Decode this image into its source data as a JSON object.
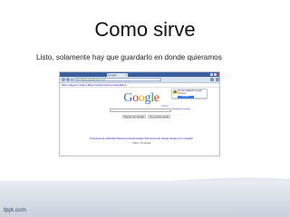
{
  "slide": {
    "title": "Como sirve",
    "body": "Listo, solamente hay que guardarlo en donde quieramos",
    "footer": "fppt.com"
  },
  "browser": {
    "tab_label": "Google",
    "tab_close": "×",
    "url": "http://www.google.com.mx/",
    "star": "☆",
    "google_top_links": "Web  Imágenes  Videos  Maps  Noticias  Libros  Gmail  Más ▾",
    "bubble_text": "Se ha instalado Google Chrome",
    "bubble_button": "Aceptar",
    "logo": {
      "G": "G",
      "o1": "o",
      "o2": "o",
      "g": "g",
      "l": "l",
      "e": "e"
    },
    "logo_sub": "México",
    "search_side_links": "Búsqueda avanzada",
    "search_button": "Buscar con Google",
    "lucky_button": "Voy a tener suerte",
    "footer_links": "Programas de publicidad   Soluciones Empresariales   Todo acerca de Google   Google.com in English",
    "footer_copy": "©2010 · Privacidad"
  },
  "colors": {
    "title_bar": "#3b5f9c",
    "toolbar": "#dbe4f1",
    "link": "#1a0dab",
    "google_blue": "#3b6fe0",
    "google_red": "#d93025",
    "google_yellow": "#e8b100",
    "google_green": "#2a9a3f"
  },
  "icons": {
    "back": "back-icon",
    "forward": "forward-icon",
    "reload": "reload-icon",
    "bookmark": "star-icon",
    "page": "page-icon",
    "tools": "wrench-icon",
    "chrome": "chrome-icon"
  }
}
